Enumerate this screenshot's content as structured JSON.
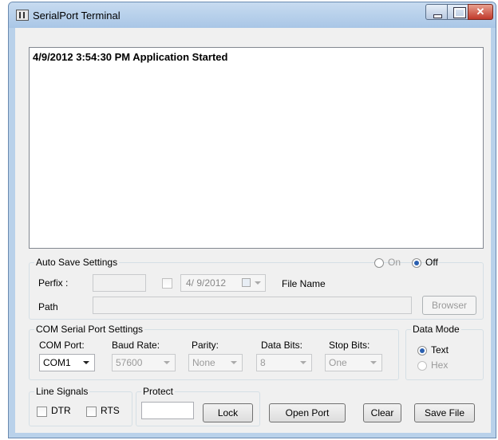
{
  "window": {
    "title": "SerialPort Terminal"
  },
  "log": {
    "text": "4/9/2012 3:54:30 PM Application Started"
  },
  "autosave": {
    "group_label": "Auto Save Settings",
    "on_label": "On",
    "off_label": "Off",
    "selected": "Off",
    "perfix_label": "Perfix :",
    "date_value": "4/ 9/2012",
    "file_name_label": "File Name",
    "path_label": "Path",
    "browser_label": "Browser"
  },
  "com": {
    "group_label": "COM Serial Port Settings",
    "com_port_label": "COM Port:",
    "com_port_value": "COM1",
    "baud_label": "Baud Rate:",
    "baud_value": "57600",
    "parity_label": "Parity:",
    "parity_value": "None",
    "databits_label": "Data Bits:",
    "databits_value": "8",
    "stopbits_label": "Stop Bits:",
    "stopbits_value": "One"
  },
  "datamode": {
    "group_label": "Data Mode",
    "text_label": "Text",
    "hex_label": "Hex",
    "selected": "Text"
  },
  "linesignals": {
    "group_label": "Line Signals",
    "dtr_label": "DTR",
    "rts_label": "RTS"
  },
  "protect": {
    "group_label": "Protect",
    "lock_label": "Lock"
  },
  "actions": {
    "open_port_label": "Open Port",
    "clear_label": "Clear",
    "save_file_label": "Save File"
  },
  "colors": {
    "titlebar": "#b9d1ea",
    "close_button": "#c0392b",
    "radio_selected": "#2a5fb0"
  }
}
